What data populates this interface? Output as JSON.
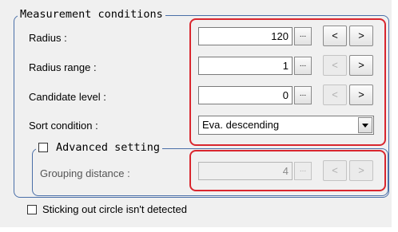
{
  "measurement": {
    "title": "Measurement conditions",
    "rows": [
      {
        "label": "Radius :",
        "value": "120",
        "ellipsis": "...",
        "dec": "<",
        "inc": ">"
      },
      {
        "label": "Radius range :",
        "value": "1",
        "ellipsis": "...",
        "dec": "<",
        "inc": ">"
      },
      {
        "label": "Candidate level :",
        "value": "0",
        "ellipsis": "...",
        "dec": "<",
        "inc": ">"
      }
    ],
    "sort": {
      "label": "Sort condition :",
      "value": "Eva. descending"
    }
  },
  "advanced": {
    "title": "Advanced setting",
    "checked": false,
    "grouping": {
      "label": "Grouping distance :",
      "value": "4",
      "ellipsis": "...",
      "dec": "<",
      "inc": ">"
    }
  },
  "options": {
    "sticking_out_label": "Sticking out circle isn't detected",
    "sticking_out_checked": false
  },
  "colors": {
    "highlight": "#d9262e",
    "group_border": "#4a6fa8"
  }
}
